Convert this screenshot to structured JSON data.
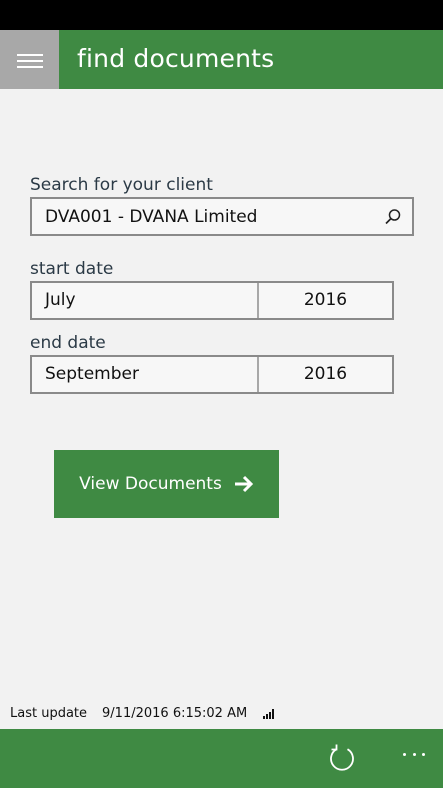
{
  "header": {
    "title": "find documents",
    "menu_icon": "hamburger-icon"
  },
  "search": {
    "label": "Search for your client",
    "value": "DVA001 - DVANA Limited",
    "icon": "search-icon"
  },
  "start_date": {
    "label": "start date",
    "month": "July",
    "year": "2016"
  },
  "end_date": {
    "label": "end date",
    "month": "September",
    "year": "2016"
  },
  "view_button": {
    "label": "View Documents",
    "icon": "arrow-right-icon"
  },
  "footer": {
    "last_update_label": "Last update",
    "last_update_value": "9/11/2016 6:15:02 AM",
    "signal_icon": "signal-icon"
  },
  "app_bar": {
    "refresh_icon": "refresh-icon",
    "more_icon": "more-icon"
  },
  "colors": {
    "accent": "#3f8a43",
    "menu_button": "#a8a8a8",
    "background": "#f2f2f2",
    "label_text": "#2b3a46"
  }
}
